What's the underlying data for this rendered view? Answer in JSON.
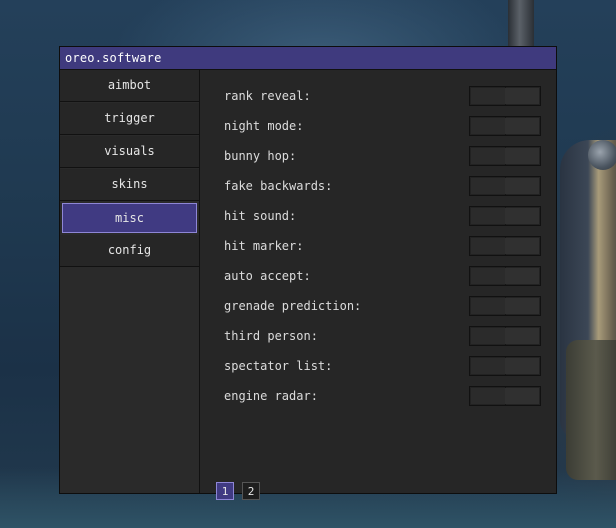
{
  "window": {
    "title": "oreo.software"
  },
  "sidebar": {
    "items": [
      {
        "label": "aimbot"
      },
      {
        "label": "trigger"
      },
      {
        "label": "visuals"
      },
      {
        "label": "skins"
      },
      {
        "label": "misc",
        "active": true
      },
      {
        "label": "config"
      }
    ]
  },
  "misc": {
    "options": [
      {
        "label": "rank reveal:",
        "enabled": false
      },
      {
        "label": "night mode:",
        "enabled": false
      },
      {
        "label": "bunny hop:",
        "enabled": false
      },
      {
        "label": "fake backwards:",
        "enabled": false
      },
      {
        "label": "hit sound:",
        "enabled": false
      },
      {
        "label": "hit marker:",
        "enabled": false
      },
      {
        "label": "auto accept:",
        "enabled": false
      },
      {
        "label": "grenade prediction:",
        "enabled": false
      },
      {
        "label": "third person:",
        "enabled": false
      },
      {
        "label": "spectator list:",
        "enabled": false
      },
      {
        "label": "engine radar:",
        "enabled": false
      }
    ],
    "pages": [
      {
        "label": "1",
        "active": true
      },
      {
        "label": "2",
        "active": false
      }
    ]
  },
  "colors": {
    "accent": "#403a82",
    "accent_border": "#8e86d6",
    "panel": "#262626"
  }
}
